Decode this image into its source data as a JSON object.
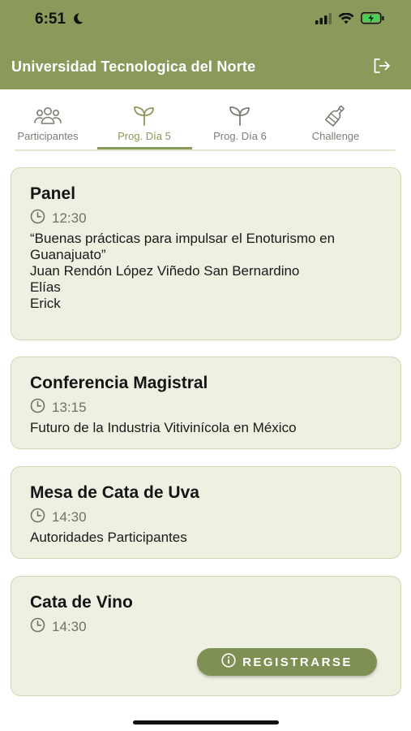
{
  "status": {
    "time": "6:51"
  },
  "header": {
    "title": "Universidad Tecnologica del Norte"
  },
  "tabs": [
    {
      "label": "Participantes",
      "icon": "people-icon",
      "active": false
    },
    {
      "label": "Prog. Día 5",
      "icon": "sprout-icon",
      "active": true
    },
    {
      "label": "Prog. Día 6",
      "icon": "sprout-icon",
      "active": false
    },
    {
      "label": "Challenge",
      "icon": "wine-bottle-icon",
      "active": false
    }
  ],
  "events": [
    {
      "title": "Panel",
      "time": "12:30",
      "description": "“Buenas prácticas para impulsar el Enoturismo en Guanajuato”\nJuan Rendón López Viñedo San Bernardino\nElías\nErick"
    },
    {
      "title": "Conferencia Magistral",
      "time": "13:15",
      "description": "Futuro de la Industria Vitivinícola en México"
    },
    {
      "title": "Mesa de Cata de Uva",
      "time": "14:30",
      "description": "Autoridades Participantes"
    },
    {
      "title": "Cata de Vino",
      "time": "14:30",
      "register_label": "REGISTRARSE"
    }
  ],
  "colors": {
    "accent": "#8a9a5b",
    "card_bg": "#eef1e2",
    "card_border": "#cfd8b4"
  }
}
